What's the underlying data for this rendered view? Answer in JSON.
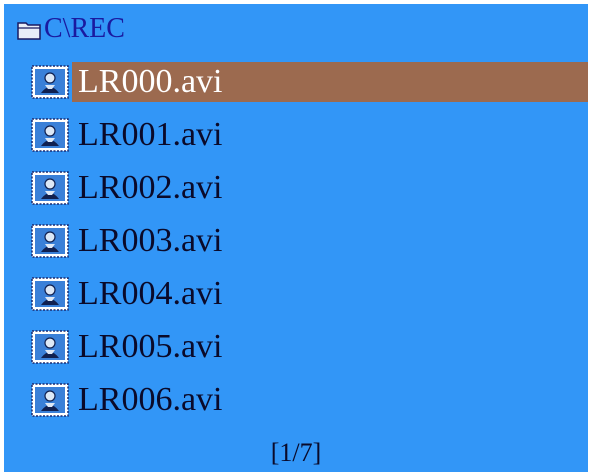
{
  "colors": {
    "background": "#3296f7",
    "selection": "#9c6a4f",
    "path_text": "#1a1aa0",
    "item_text": "#0a0a2a",
    "selected_text": "#ffffff"
  },
  "header": {
    "icon": "folder-icon",
    "path": "C\\REC"
  },
  "files": [
    {
      "name": "LR000.avi",
      "icon": "video-file-icon",
      "selected": true
    },
    {
      "name": "LR001.avi",
      "icon": "video-file-icon",
      "selected": false
    },
    {
      "name": "LR002.avi",
      "icon": "video-file-icon",
      "selected": false
    },
    {
      "name": "LR003.avi",
      "icon": "video-file-icon",
      "selected": false
    },
    {
      "name": "LR004.avi",
      "icon": "video-file-icon",
      "selected": false
    },
    {
      "name": "LR005.avi",
      "icon": "video-file-icon",
      "selected": false
    },
    {
      "name": "LR006.avi",
      "icon": "video-file-icon",
      "selected": false
    }
  ],
  "footer": {
    "page_indicator": "[1/7]"
  }
}
